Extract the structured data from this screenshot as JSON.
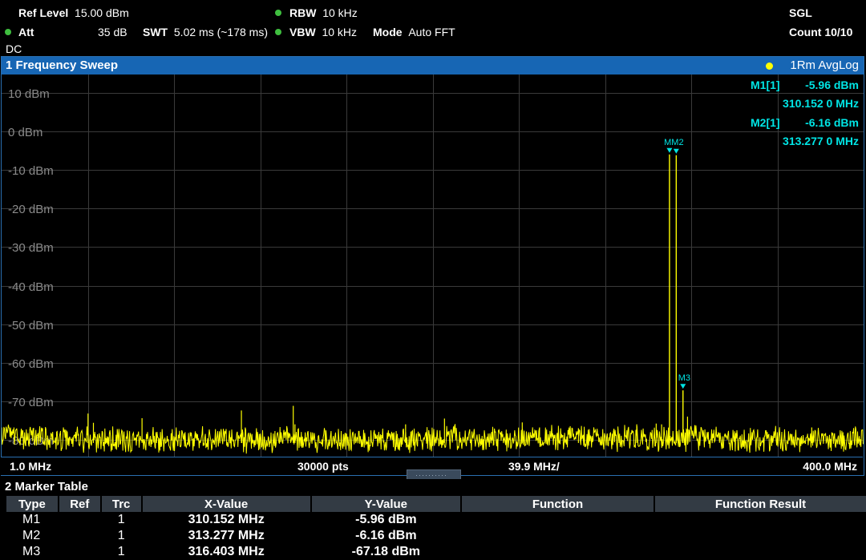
{
  "header": {
    "ref_level_label": "Ref Level",
    "ref_level_value": "15.00 dBm",
    "att_label": "Att",
    "att_value": "35 dB",
    "swt_label": "SWT",
    "swt_value": "5.02 ms (~178 ms)",
    "rbw_label": "RBW",
    "rbw_value": "10 kHz",
    "vbw_label": "VBW",
    "vbw_value": "10 kHz",
    "mode_label": "Mode",
    "mode_value": "Auto FFT",
    "coupling": "DC",
    "sweep_mode": "SGL",
    "count": "Count 10/10"
  },
  "diagram": {
    "title": "1 Frequency Sweep",
    "trace_label": "1Rm AvgLog",
    "marker_readout": [
      {
        "name": "M1[1]",
        "level": "-5.96 dBm",
        "freq": "310.152 0 MHz"
      },
      {
        "name": "M2[1]",
        "level": "-6.16 dBm",
        "freq": "313.277 0 MHz"
      }
    ],
    "y_ticks": [
      "10 dBm",
      "0 dBm",
      "-10 dBm",
      "-20 dBm",
      "-30 dBm",
      "-40 dBm",
      "-50 dBm",
      "-60 dBm",
      "-70 dBm",
      "-80 dBm"
    ],
    "x_start": "1.0 MHz",
    "points": "30000 pts",
    "x_div": "39.9 MHz/",
    "x_stop": "400.0 MHz",
    "marker_flags": [
      "M1",
      "M2",
      "M3"
    ]
  },
  "colors": {
    "trace": "#ffff00",
    "marker_text": "#00e5e5",
    "title_bar": "#1766b4",
    "grid": "#3a3a3a"
  },
  "chart_data": {
    "type": "line",
    "x_unit": "MHz",
    "y_unit": "dBm",
    "xlim": [
      1.0,
      400.0
    ],
    "ylim": [
      -88,
      15
    ],
    "noise_floor_dbm": -80,
    "markers": [
      {
        "name": "M1",
        "x": 310.152,
        "y": -5.96
      },
      {
        "name": "M2",
        "x": 313.277,
        "y": -6.16
      },
      {
        "name": "M3",
        "x": 316.403,
        "y": -67.18
      }
    ],
    "spurs": [
      {
        "x": 41.0,
        "y": -73.2
      },
      {
        "x": 43.5,
        "y": -75.6
      },
      {
        "x": 66.0,
        "y": -74.4
      },
      {
        "x": 112.0,
        "y": -72.4
      },
      {
        "x": 136.0,
        "y": -71.2
      },
      {
        "x": 136.8,
        "y": -76.0
      },
      {
        "x": 188.0,
        "y": -76.0
      },
      {
        "x": 206.0,
        "y": -74.5
      },
      {
        "x": 242.0,
        "y": -75.5
      },
      {
        "x": 250.0,
        "y": -76.8
      },
      {
        "x": 268.0,
        "y": -77.0
      },
      {
        "x": 295.0,
        "y": -76.0
      },
      {
        "x": 304.0,
        "y": -75.8
      },
      {
        "x": 306.5,
        "y": -76.0
      },
      {
        "x": 318.5,
        "y": -74.0
      },
      {
        "x": 376.0,
        "y": -76.8
      }
    ]
  },
  "marker_table": {
    "title": "2 Marker Table",
    "columns": [
      "Type",
      "Ref",
      "Trc",
      "X-Value",
      "Y-Value",
      "Function",
      "Function Result"
    ],
    "rows": [
      {
        "type": "M1",
        "ref": "",
        "trc": "1",
        "x": "310.152 MHz",
        "y": "-5.96 dBm",
        "func": "",
        "result": ""
      },
      {
        "type": "M2",
        "ref": "",
        "trc": "1",
        "x": "313.277 MHz",
        "y": "-6.16 dBm",
        "func": "",
        "result": ""
      },
      {
        "type": "M3",
        "ref": "",
        "trc": "1",
        "x": "316.403 MHz",
        "y": "-67.18 dBm",
        "func": "",
        "result": ""
      }
    ]
  }
}
